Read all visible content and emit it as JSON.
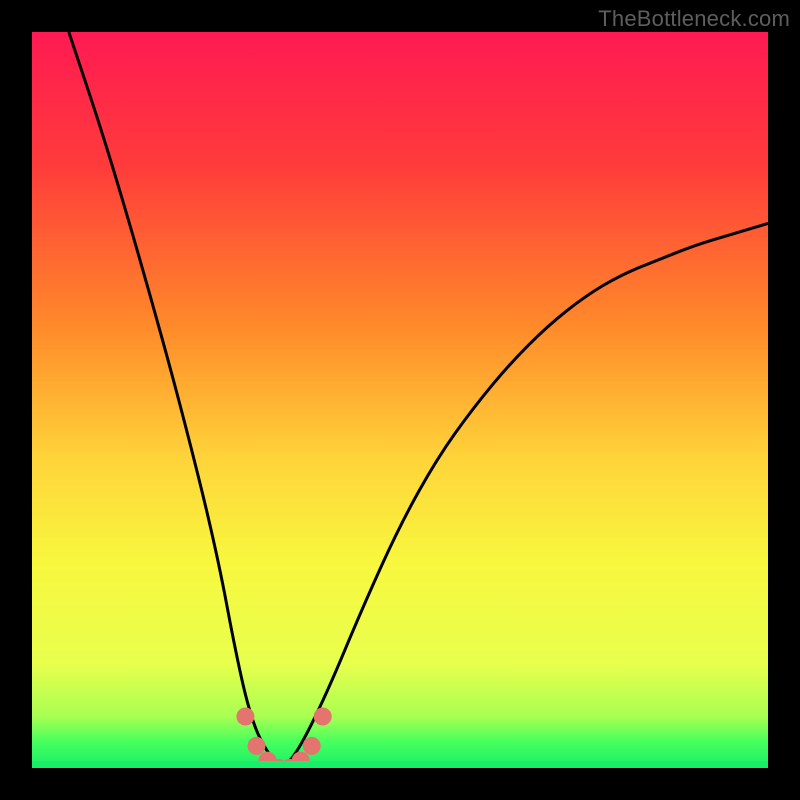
{
  "watermark": "TheBottleneck.com",
  "colors": {
    "curve_black": "#000000",
    "marker_fill": "#e4746e",
    "green_cap": "#18ef68"
  },
  "chart_data": {
    "type": "line",
    "title": "",
    "xlabel": "",
    "ylabel": "",
    "xlim": [
      0,
      100
    ],
    "ylim": [
      0,
      100
    ],
    "inverted_y_peaks_at_bottom": true,
    "series": [
      {
        "name": "black-curve",
        "x": [
          5,
          10,
          15,
          20,
          25,
          28,
          30,
          32,
          34,
          36,
          40,
          45,
          50,
          55,
          60,
          65,
          70,
          75,
          80,
          85,
          90,
          95,
          100
        ],
        "y": [
          100,
          85,
          68,
          50,
          30,
          14,
          6,
          2,
          0,
          2,
          10,
          22,
          33,
          42,
          49,
          55,
          60,
          64,
          67,
          69,
          71,
          72.5,
          74
        ]
      }
    ],
    "markers": {
      "name": "valley-highlight",
      "x": [
        29,
        30.5,
        32,
        33.5,
        35,
        36.5,
        38,
        39.5
      ],
      "y": [
        7,
        3,
        1,
        0,
        0,
        1,
        3,
        7
      ]
    },
    "gradient_stops": [
      {
        "pos": 0.0,
        "color": "#ff1a53"
      },
      {
        "pos": 0.18,
        "color": "#ff3b3b"
      },
      {
        "pos": 0.4,
        "color": "#ff8a2a"
      },
      {
        "pos": 0.58,
        "color": "#ffd43a"
      },
      {
        "pos": 0.72,
        "color": "#f8f73e"
      },
      {
        "pos": 0.86,
        "color": "#e7ff4d"
      },
      {
        "pos": 0.93,
        "color": "#a8ff52"
      },
      {
        "pos": 0.965,
        "color": "#45ff5d"
      },
      {
        "pos": 1.0,
        "color": "#18ef68"
      }
    ]
  }
}
